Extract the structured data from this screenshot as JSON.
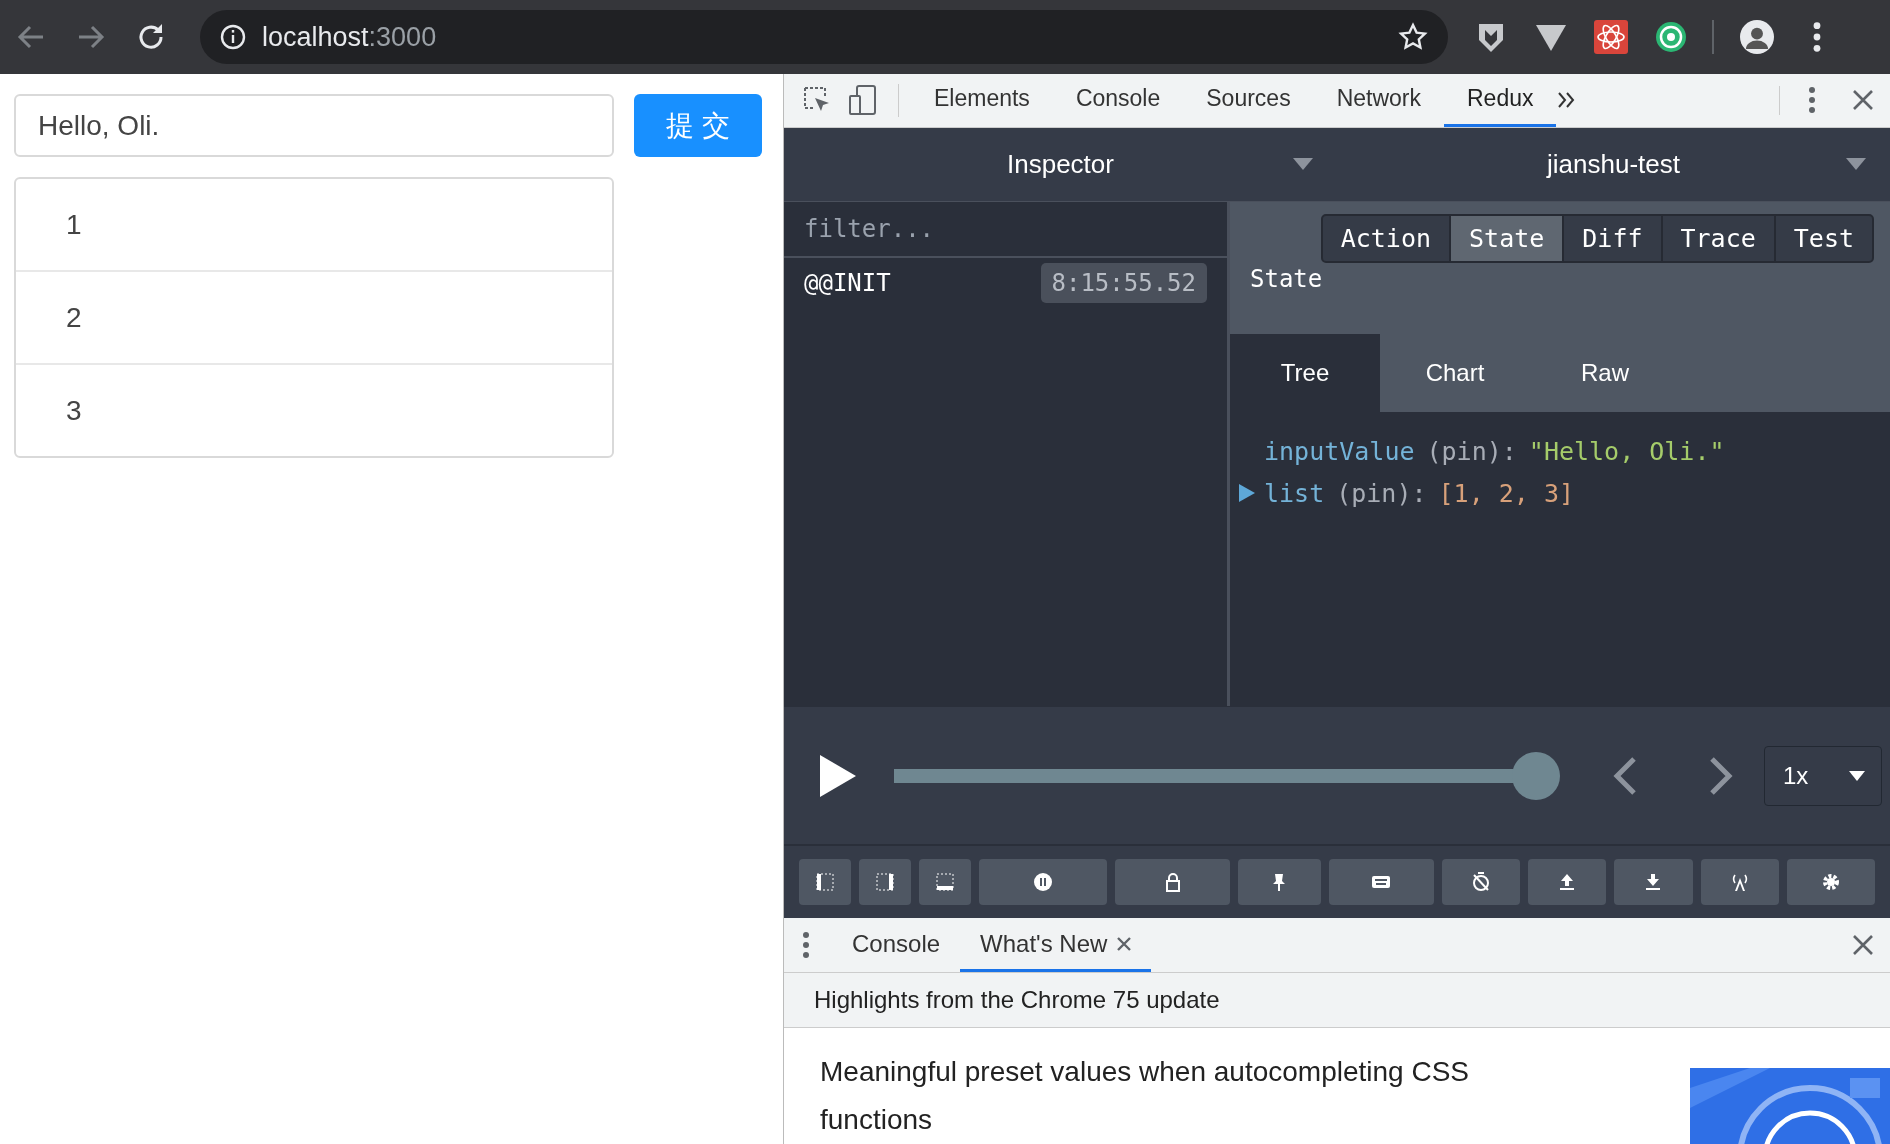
{
  "browser": {
    "url_host": "localhost",
    "url_port": ":3000"
  },
  "page": {
    "input": {
      "value": "Hello, Oli."
    },
    "submit": "提 交",
    "list": [
      "1",
      "2",
      "3"
    ]
  },
  "devtools": {
    "tabs": [
      {
        "label": "Elements",
        "selected": false
      },
      {
        "label": "Console",
        "selected": false
      },
      {
        "label": "Sources",
        "selected": false
      },
      {
        "label": "Network",
        "selected": false
      },
      {
        "label": "Redux",
        "selected": true
      }
    ],
    "redux": {
      "monitor": "Inspector",
      "store": "jianshu-test",
      "filter": {
        "placeholder": "filter..."
      },
      "actions": [
        {
          "name": "@@INIT",
          "time": "8:15:55.52",
          "selected": false
        }
      ],
      "view_tabs": [
        {
          "label": "Action",
          "selected": false
        },
        {
          "label": "State",
          "selected": true
        },
        {
          "label": "Diff",
          "selected": false
        },
        {
          "label": "Trace",
          "selected": false
        },
        {
          "label": "Test",
          "selected": false
        }
      ],
      "section_title": "State",
      "sub_tabs": [
        {
          "label": "Tree",
          "selected": true
        },
        {
          "label": "Chart",
          "selected": false
        },
        {
          "label": "Raw",
          "selected": false
        }
      ],
      "tree": [
        {
          "key": "inputValue",
          "note": "(pin):",
          "value": "\"Hello, Oli.\"",
          "kind": "string"
        },
        {
          "key": "list",
          "note": "(pin):",
          "value": "[1, 2, 3]",
          "kind": "array",
          "expanded": false
        }
      ],
      "slider": {
        "level": 1.0,
        "speed": "1x"
      },
      "toolbar": [
        {
          "kind": "dock-left"
        },
        {
          "kind": "dock-right"
        },
        {
          "kind": "dock-bottom"
        },
        {
          "kind": "pause"
        },
        {
          "kind": "lock"
        },
        {
          "kind": "pin"
        },
        {
          "kind": "keyboard"
        },
        {
          "kind": "timer"
        },
        {
          "kind": "upload"
        },
        {
          "kind": "download"
        },
        {
          "kind": "remote"
        },
        {
          "kind": "settings"
        }
      ]
    },
    "drawer": {
      "tabs": [
        {
          "label": "Console",
          "selected": false,
          "closable": false
        },
        {
          "label": "What's New",
          "selected": true,
          "closable": true
        }
      ],
      "subtitle": "Highlights from the Chrome 75 update",
      "heading": "Meaningful preset values when autocompleting CSS functions"
    }
  }
}
